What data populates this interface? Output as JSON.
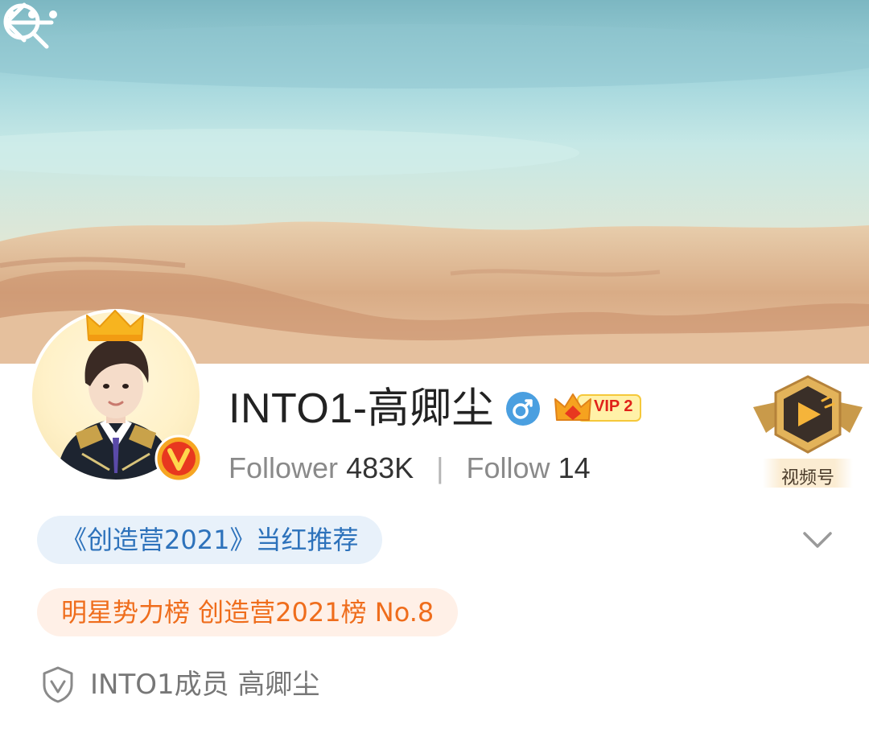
{
  "profile": {
    "username": "INTO1-高卿尘",
    "gender": "male",
    "vip_label": "VIP 2",
    "verified": true
  },
  "stats": {
    "follower_label": "Follower",
    "follower_value": "483K",
    "separator": "|",
    "follow_label": "Follow",
    "follow_value": "14"
  },
  "channel": {
    "label": "视频号",
    "icon": "video-channel-icon"
  },
  "tags": {
    "recommend": "《创造营2021》当红推荐",
    "ranking": "明星势力榜 创造营2021榜 No.8"
  },
  "verification": {
    "text": "INTO1成员 高卿尘",
    "icon": "shield-icon"
  },
  "icons": {
    "back": "back-arrow-icon",
    "search": "search-icon",
    "more": "more-icon",
    "expand": "chevron-down-icon",
    "crown": "crown-icon",
    "verified": "verified-v-icon"
  },
  "colors": {
    "tag_blue_bg": "#e8f1fa",
    "tag_blue_text": "#2d72bb",
    "tag_orange_bg": "#fff0e7",
    "tag_orange_text": "#ef6d1c",
    "vip_red": "#e0221a",
    "gender_blue": "#4a9fe0"
  }
}
